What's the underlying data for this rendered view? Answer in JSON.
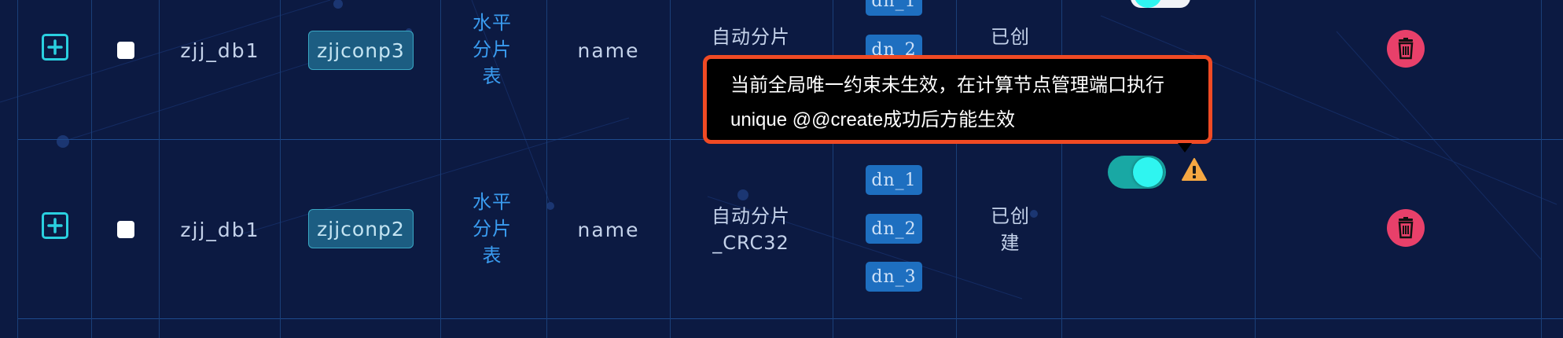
{
  "rows": [
    {
      "db": "zjj_db1",
      "table": "zjjconp3",
      "type_lines": [
        "水平",
        "分片",
        "表"
      ],
      "column": "name",
      "strategy_lines": [
        "自动分片"
      ],
      "nodes": [
        "dn_1",
        "dn_2"
      ],
      "status_lines": [
        "已创"
      ],
      "enabled": false
    },
    {
      "db": "zjj_db1",
      "table": "zjjconp2",
      "type_lines": [
        "水平",
        "分片",
        "表"
      ],
      "column": "name",
      "strategy_lines": [
        "自动分片",
        "_CRC32"
      ],
      "nodes": [
        "dn_1",
        "dn_2",
        "dn_3"
      ],
      "status_lines": [
        "已创",
        "建"
      ],
      "enabled": true
    }
  ],
  "tooltip": {
    "line1": "当前全局唯一约束未生效，在计算节点管理端口执行",
    "line2": "unique @@create成功后方能生效"
  },
  "icons": {
    "expand": "plus-square-icon",
    "delete": "trash-icon",
    "warning": "warning-triangle-icon"
  },
  "colors": {
    "background": "#0c1a42",
    "accent_cyan": "#2ad0e0",
    "chip_blue": "#1e6fc0",
    "delete_red": "#e8406a",
    "warning_orange": "#f5a742",
    "tooltip_border": "#f04a24"
  }
}
